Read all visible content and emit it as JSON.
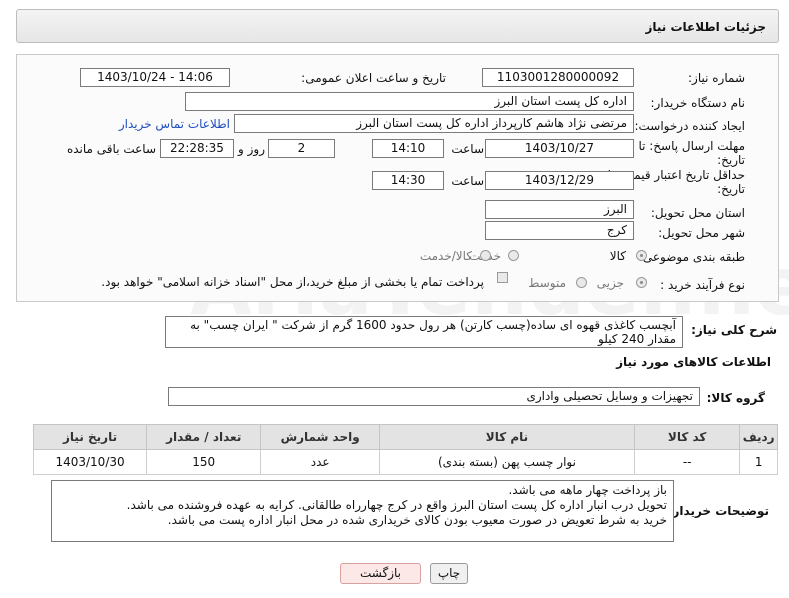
{
  "header": {
    "title": "جزئیات اطلاعات نیاز"
  },
  "form": {
    "need_number_label": "شماره نیاز:",
    "need_number": "1103001280000092",
    "announce_label": "تاریخ و ساعت اعلان عمومی:",
    "announce_value": "1403/10/24 - 14:06",
    "buyer_org_label": "نام دستگاه خریدار:",
    "buyer_org": "اداره کل پست استان البرز",
    "requester_label": "ایجاد کننده درخواست:",
    "requester": "مرتضی  نژاد هاشم کارپرداز اداره کل پست استان البرز",
    "contact_link": "اطلاعات تماس خریدار",
    "deadline_label_1": "مهلت ارسال پاسخ: تا",
    "deadline_label_2": "تاریخ:",
    "deadline_date": "1403/10/27",
    "time_label": "ساعت",
    "deadline_time": "14:10",
    "days_value": "2",
    "days_label": "روز و",
    "remaining_time": "22:28:35",
    "remaining_label": "ساعت باقی مانده",
    "validity_label_1": "حداقل تاریخ اعتبار قیمت: تا",
    "validity_label_2": "تاریخ:",
    "validity_date": "1403/12/29",
    "validity_time": "14:30",
    "province_label": "استان محل تحویل:",
    "province": "البرز",
    "city_label": "شهر محل تحویل:",
    "city": "کرج",
    "category_label": "طبقه بندی موضوعی:",
    "category_options": [
      "کالا",
      "خدمت",
      "کالا/خدمت"
    ],
    "process_label": "نوع فرآیند خرید :",
    "process_options": [
      "جزیی",
      "متوسط"
    ],
    "payment_note": "پرداخت تمام یا بخشی از مبلغ خرید،از محل \"اسناد خزانه اسلامی\" خواهد بود."
  },
  "summary": {
    "label": "شرح کلی نیاز:",
    "text": "آبچسب کاغذی قهوه ای ساده(چسب کارتن) هر رول حدود 1600 گرم از شرکت \" ایران چسب\" به مقدار 240 کیلو"
  },
  "goods": {
    "section_title": "اطلاعات کالاهای مورد نیاز",
    "group_label": "گروه کالا:",
    "group_value": "تجهیزات و وسایل تحصیلی واداری",
    "columns": [
      "ردیف",
      "کد کالا",
      "نام کالا",
      "واحد شمارش",
      "تعداد / مقدار",
      "تاریخ نیاز"
    ],
    "rows": [
      [
        "1",
        "--",
        "نوار چسب پهن (بسته بندی)",
        "عدد",
        "150",
        "1403/10/30"
      ]
    ]
  },
  "buyer_notes": {
    "label": "توضیحات خریدار:",
    "text": "باز پرداخت چهار ماهه می باشد.\nتحویل درب انبار اداره کل پست استان البرز واقع در کرج چهارراه طالقانی. کرایه به عهده فروشنده می باشد.\nخرید به شرط تعویض در صورت معیوب بودن کالای خریداری شده در محل انبار اداره پست می باشد."
  },
  "buttons": {
    "print": "چاپ",
    "back": "بازگشت"
  },
  "watermark": "AriaTender.neT",
  "colors": {
    "link": "#1f4fbf",
    "back_button_bg": "#fde8e8",
    "back_button_border": "#d9a0a0"
  }
}
